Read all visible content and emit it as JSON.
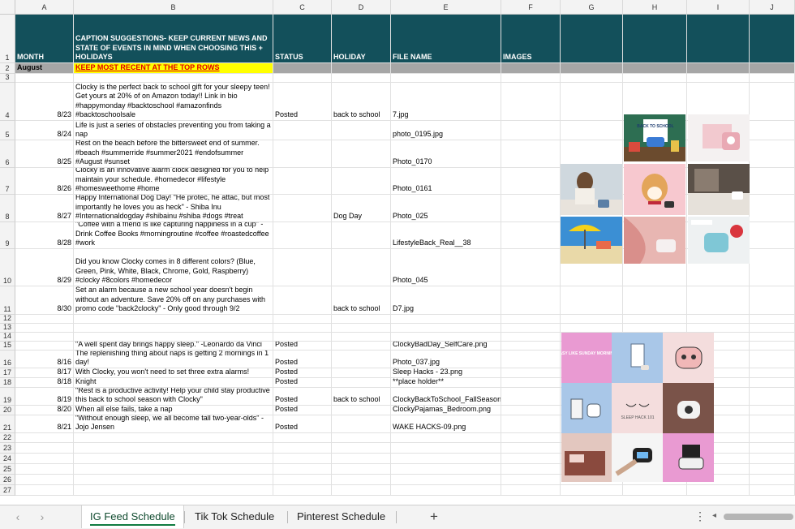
{
  "columns": [
    "A",
    "B",
    "C",
    "D",
    "E",
    "F",
    "G",
    "H",
    "I",
    "J"
  ],
  "header": {
    "month": "MONTH",
    "caption": "CAPTION SUGGESTIONS- KEEP CURRENT NEWS AND STATE OF EVENTS IN MIND WHEN CHOOSING THIS + HOLIDAYS",
    "status": "STATUS",
    "holiday": "HOLIDAY",
    "file_name": "FILE NAME",
    "images": "IMAGES"
  },
  "month_row": {
    "month": "August",
    "note": "KEEP MOST RECENT AT THE TOP ROWS"
  },
  "rows": [
    {
      "num": "3",
      "date": "",
      "caption": "",
      "status": "",
      "holiday": "",
      "file": ""
    },
    {
      "num": "4",
      "date": "8/23",
      "caption": "Clocky is the perfect back to school gift for your sleepy teen! Get yours at 20% of on Amazon today!! Link in bio #happymonday #backtoschool #amazonfinds #backtoschoolsale",
      "status": "Posted",
      "holiday": "back to school",
      "file": "7.jpg"
    },
    {
      "num": "5",
      "date": "8/24",
      "caption": "Life is just a series of obstacles preventing you from taking a nap",
      "status": "",
      "holiday": "",
      "file": "photo_0195.jpg"
    },
    {
      "num": "6",
      "date": "8/25",
      "caption": "Rest on the beach before the bittersweet end of summer. #beach #summerride #summer2021 #endofsummer #August #sunset",
      "status": "",
      "holiday": "",
      "file": "Photo_0170"
    },
    {
      "num": "7",
      "date": "8/26",
      "caption": "Clocky is an innovative alarm clock designed for you to help maintain your schedule. #homedecor #lifestyle #homesweethome #home",
      "status": "",
      "holiday": "",
      "file": "Photo_0161"
    },
    {
      "num": "8",
      "date": "8/27",
      "caption": "Happy International Dog Day! \"He protec, he attac, but most importantly he loves you as heck\" - Shiba Inu #Internationaldogday #shibainu #shiba #dogs #treat",
      "status": "",
      "holiday": "Dog Day",
      "file": "Photo_025"
    },
    {
      "num": "9",
      "date": "8/28",
      "caption": "\"Coffee with a friend is like capturing happiness in a cup\" - Drink Coffee Books #morningroutine #coffee #roastedcoffee #work",
      "status": "",
      "holiday": "",
      "file": "LifestyleBack_Real__38"
    },
    {
      "num": "10",
      "date": "8/29",
      "caption": "Did you know Clocky comes in 8 different colors? (Blue, Green, Pink, White, Black, Chrome, Gold, Raspberry) #clocky #8colors #homedecor",
      "status": "",
      "holiday": "",
      "file": "Photo_045"
    },
    {
      "num": "11",
      "date": "8/30",
      "caption": "Set an alarm because a new school year doesn't begin without an adventure. Save 20% off on any purchases with promo code \"back2clocky\" - Only good through 9/2",
      "status": "",
      "holiday": "back to school",
      "file": "D7.jpg"
    },
    {
      "num": "12",
      "date": "",
      "caption": "",
      "status": "",
      "holiday": "",
      "file": ""
    },
    {
      "num": "13",
      "date": "",
      "caption": "",
      "status": "",
      "holiday": "",
      "file": ""
    },
    {
      "num": "14",
      "date": "",
      "caption": "",
      "status": "",
      "holiday": "",
      "file": ""
    },
    {
      "num": "15",
      "date": "",
      "caption": "\"A well spent day brings happy sleep.\" -Leonardo da Vinci",
      "status": "Posted",
      "holiday": "",
      "file": "ClockyBadDay_SelfCare.png"
    },
    {
      "num": "16",
      "date": "8/16",
      "caption": "The replenishing thing about naps is getting 2 mornings in 1 day!",
      "status": "Posted",
      "holiday": "",
      "file": "Photo_037.jpg"
    },
    {
      "num": "17",
      "date": "8/17",
      "caption": "With Clocky, you won't need to set three extra alarms!",
      "status": "Posted",
      "holiday": "",
      "file": "Sleep Hacks - 23.png"
    },
    {
      "num": "18",
      "date": "8/18",
      "caption": "\"Never waste any time you could spend sleeping\" -Frank H. Knight",
      "status": "Posted",
      "holiday": "",
      "file": "**place holder**"
    },
    {
      "num": "19",
      "date": "8/19",
      "caption": "\"Rest is a productive activity! Help your child stay productive this back to school season with Clocky\"",
      "status": "Posted",
      "holiday": "back to school",
      "file": "ClockyBackToSchool_FallSeasonal"
    },
    {
      "num": "20",
      "date": "8/20",
      "caption": "When all else fails, take a nap",
      "status": "Posted",
      "holiday": "",
      "file": "ClockyPajamas_Bedroom.png"
    },
    {
      "num": "21",
      "date": "8/21",
      "caption": "\"Without enough sleep, we all become tall two-year-olds\" - Jojo Jensen",
      "status": "Posted",
      "holiday": "",
      "file": "WAKE HACKS-09.png"
    },
    {
      "num": "22",
      "date": "",
      "caption": "",
      "status": "",
      "holiday": "",
      "file": ""
    },
    {
      "num": "23",
      "date": "",
      "caption": "",
      "status": "",
      "holiday": "",
      "file": ""
    },
    {
      "num": "24",
      "date": "",
      "caption": "",
      "status": "",
      "holiday": "",
      "file": ""
    },
    {
      "num": "25",
      "date": "",
      "caption": "",
      "status": "",
      "holiday": "",
      "file": ""
    },
    {
      "num": "26",
      "date": "",
      "caption": "",
      "status": "",
      "holiday": "",
      "file": ""
    },
    {
      "num": "27",
      "date": "",
      "caption": "",
      "status": "",
      "holiday": "",
      "file": ""
    }
  ],
  "thumbnail_text": {
    "easy_sunday": "EASY LIKE SUNDAY MORNING",
    "sleep_hack": "SLEEP HACK 101",
    "back_to_school": "BACK TO SCHOOL"
  },
  "tabs": [
    "IG Feed Schedule",
    "Tik Tok Schedule",
    "Pinterest Schedule"
  ],
  "icons": {
    "prev": "‹",
    "next": "›",
    "add": "+",
    "more": "⋮",
    "scroll_left": "◂"
  },
  "colors": {
    "header_teal": "#13505b",
    "month_grey": "#a6a6a6",
    "note_yellow": "#ffff00",
    "note_red": "#e00000",
    "tab_green": "#107c41"
  }
}
